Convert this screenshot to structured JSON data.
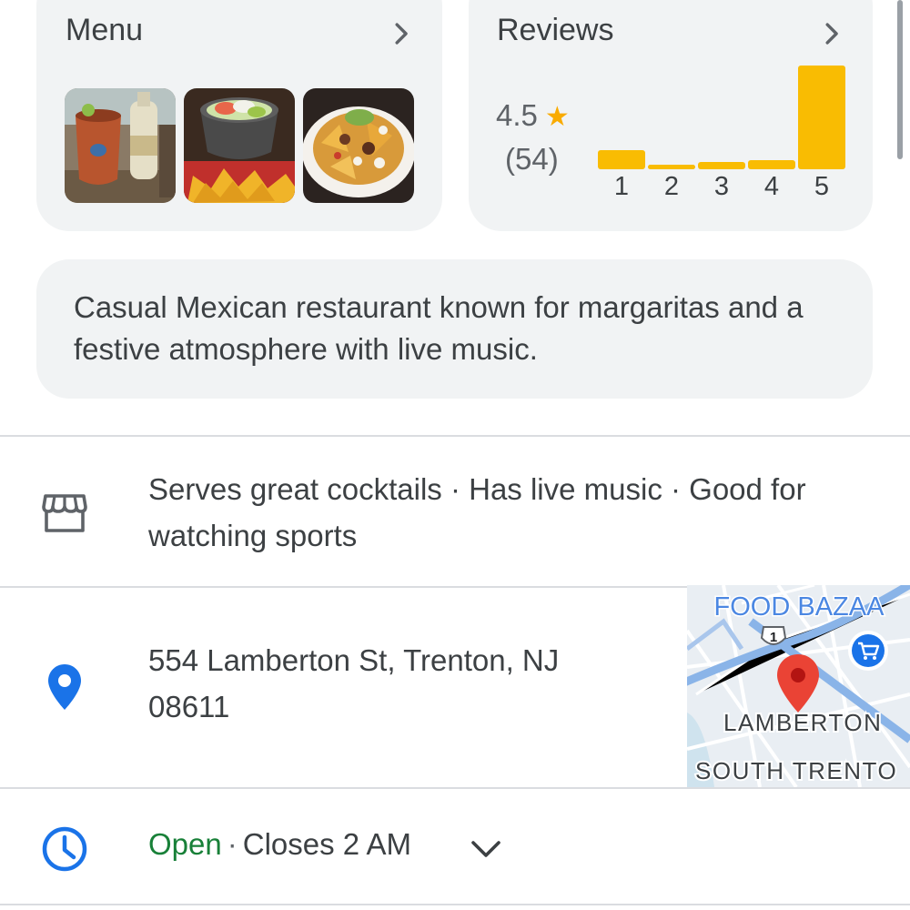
{
  "menu": {
    "title": "Menu",
    "photos": [
      {
        "name": "margarita-drink-photo"
      },
      {
        "name": "guacamole-chips-photo"
      },
      {
        "name": "nachos-photo"
      }
    ]
  },
  "reviews": {
    "title": "Reviews",
    "rating": "4.5",
    "count": "(54)",
    "star_color": "#f9ab00",
    "distribution": [
      {
        "label": "1",
        "fraction": 0.18
      },
      {
        "label": "2",
        "fraction": 0.04
      },
      {
        "label": "3",
        "fraction": 0.07
      },
      {
        "label": "4",
        "fraction": 0.09
      },
      {
        "label": "5",
        "fraction": 1.0
      }
    ],
    "bar_color": "#f9bc02"
  },
  "description": "Casual Mexican restaurant known for margaritas and a festive atmosphere with live music.",
  "highlights": {
    "icon": "storefront-icon",
    "line1": "Serves great cocktails · Has live music · Good for",
    "line2": "watching sports"
  },
  "address": {
    "icon": "location-pin-icon",
    "line1": "554 Lamberton St, Trenton, NJ",
    "line2": "08611",
    "pin_color": "#1a73e8"
  },
  "map": {
    "label_food": "FOOD BAZAA",
    "label_lamberton": "LAMBERTON",
    "label_south": "SOUTH TRENTO",
    "route_shield": "1"
  },
  "hours": {
    "icon": "clock-icon",
    "status": "Open",
    "separator": "·",
    "closes": "Closes 2 AM",
    "status_color": "#188038"
  }
}
